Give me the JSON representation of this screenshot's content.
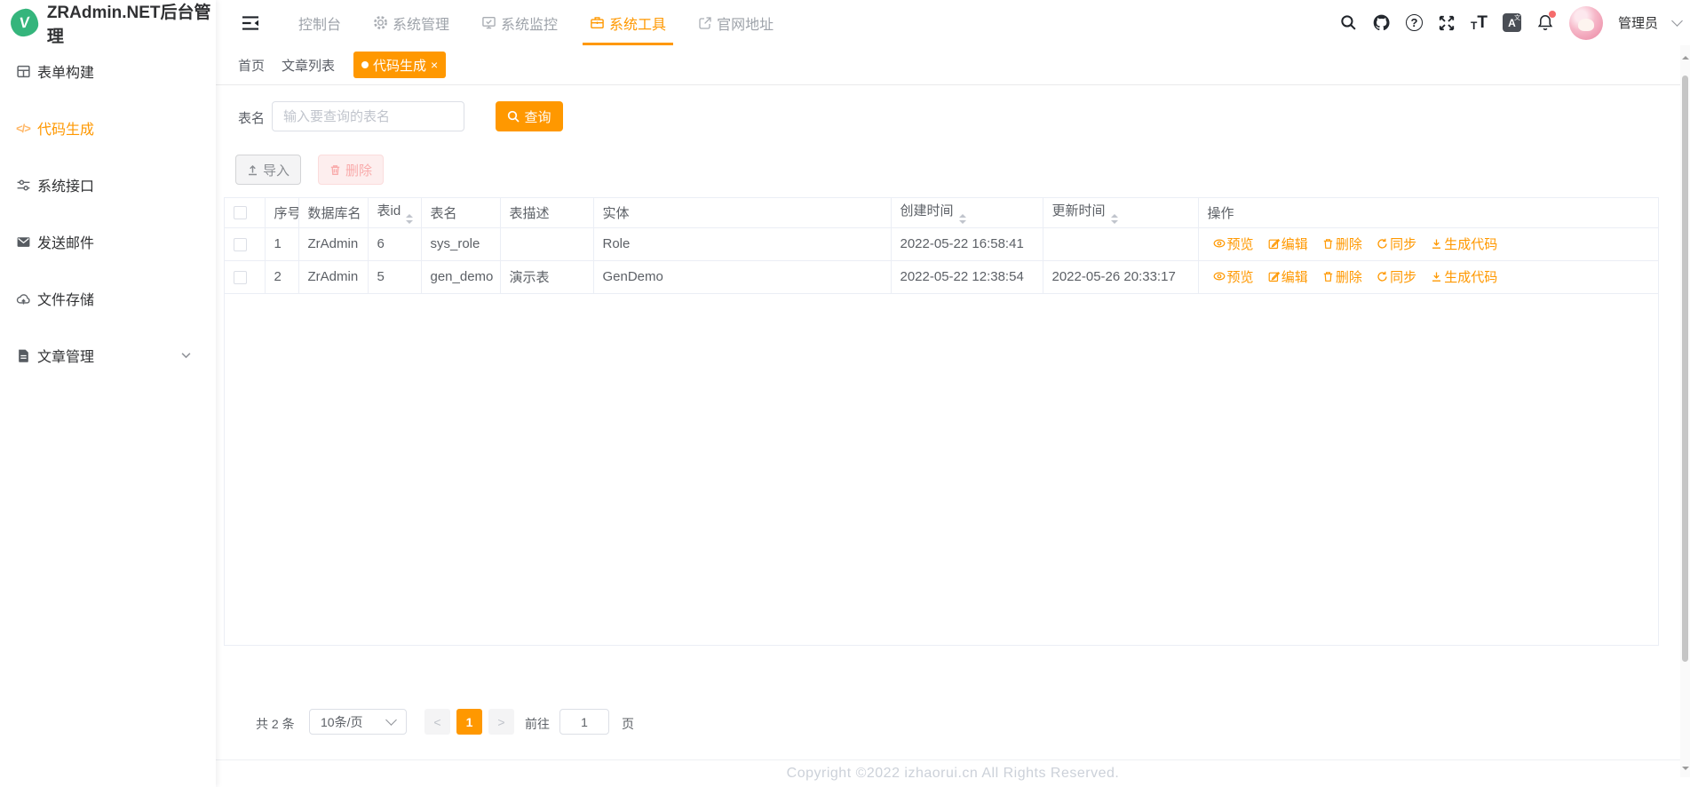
{
  "app": {
    "title": "ZRAdmin.NET后台管理",
    "logo_letter": "V"
  },
  "topnav": {
    "menu": [
      {
        "label": "控制台",
        "icon": "none",
        "active": false
      },
      {
        "label": "系统管理",
        "icon": "gear-icon",
        "active": false
      },
      {
        "label": "系统监控",
        "icon": "monitor-icon",
        "active": false
      },
      {
        "label": "系统工具",
        "icon": "toolbox-icon",
        "active": true
      },
      {
        "label": "官网地址",
        "icon": "external-link-icon",
        "active": false
      }
    ],
    "user": {
      "name": "管理员"
    }
  },
  "sidebar": {
    "menu": [
      {
        "label": "表单构建",
        "icon": "form-grid-icon",
        "active": false
      },
      {
        "label": "代码生成",
        "icon": "code-icon",
        "active": true
      },
      {
        "label": "系统接口",
        "icon": "sliders-icon",
        "active": false
      },
      {
        "label": "发送邮件",
        "icon": "mail-icon",
        "active": false
      },
      {
        "label": "文件存储",
        "icon": "cloud-upload-icon",
        "active": false
      },
      {
        "label": "文章管理",
        "icon": "document-icon",
        "active": false,
        "has_children": true
      }
    ]
  },
  "tabs": [
    {
      "label": "首页",
      "active": false
    },
    {
      "label": "文章列表",
      "active": false
    },
    {
      "label": "代码生成",
      "active": true,
      "closable": true
    }
  ],
  "query": {
    "label": "表名",
    "placeholder": "输入要查询的表名",
    "search_button": "查询"
  },
  "toolbar": {
    "import_button": "导入",
    "delete_button": "删除"
  },
  "table": {
    "headers": [
      "序号",
      "数据库名",
      "表id",
      "表名",
      "表描述",
      "实体",
      "创建时间",
      "更新时间",
      "操作"
    ],
    "sortable_columns": [
      "表id",
      "创建时间",
      "更新时间"
    ],
    "rows": [
      {
        "seq": "1",
        "database": "ZrAdmin",
        "table_id": "6",
        "table_name": "sys_role",
        "description": "",
        "entity": "Role",
        "created_at": "2022-05-22 16:58:41",
        "updated_at": ""
      },
      {
        "seq": "2",
        "database": "ZrAdmin",
        "table_id": "5",
        "table_name": "gen_demo",
        "description": "演示表",
        "entity": "GenDemo",
        "created_at": "2022-05-22 12:38:54",
        "updated_at": "2022-05-26 20:33:17"
      }
    ],
    "action_labels": [
      "预览",
      "编辑",
      "删除",
      "同步",
      "生成代码"
    ]
  },
  "pagination": {
    "total_text": "共 2 条",
    "page_size": "10条/页",
    "current_page": "1",
    "goto_label": "前往",
    "goto_value": "1",
    "goto_suffix": "页"
  },
  "footer": {
    "copyright": "Copyright ©2022 izhaorui.cn All Rights Reserved."
  },
  "colors": {
    "accent": "#ff9800",
    "notification_badge": "#f56c6c",
    "logo_green": "#35b57c",
    "table_border": "#ebeef5",
    "delete_button_bg": "#fdeeee",
    "delete_button_text": "#f9abab"
  }
}
